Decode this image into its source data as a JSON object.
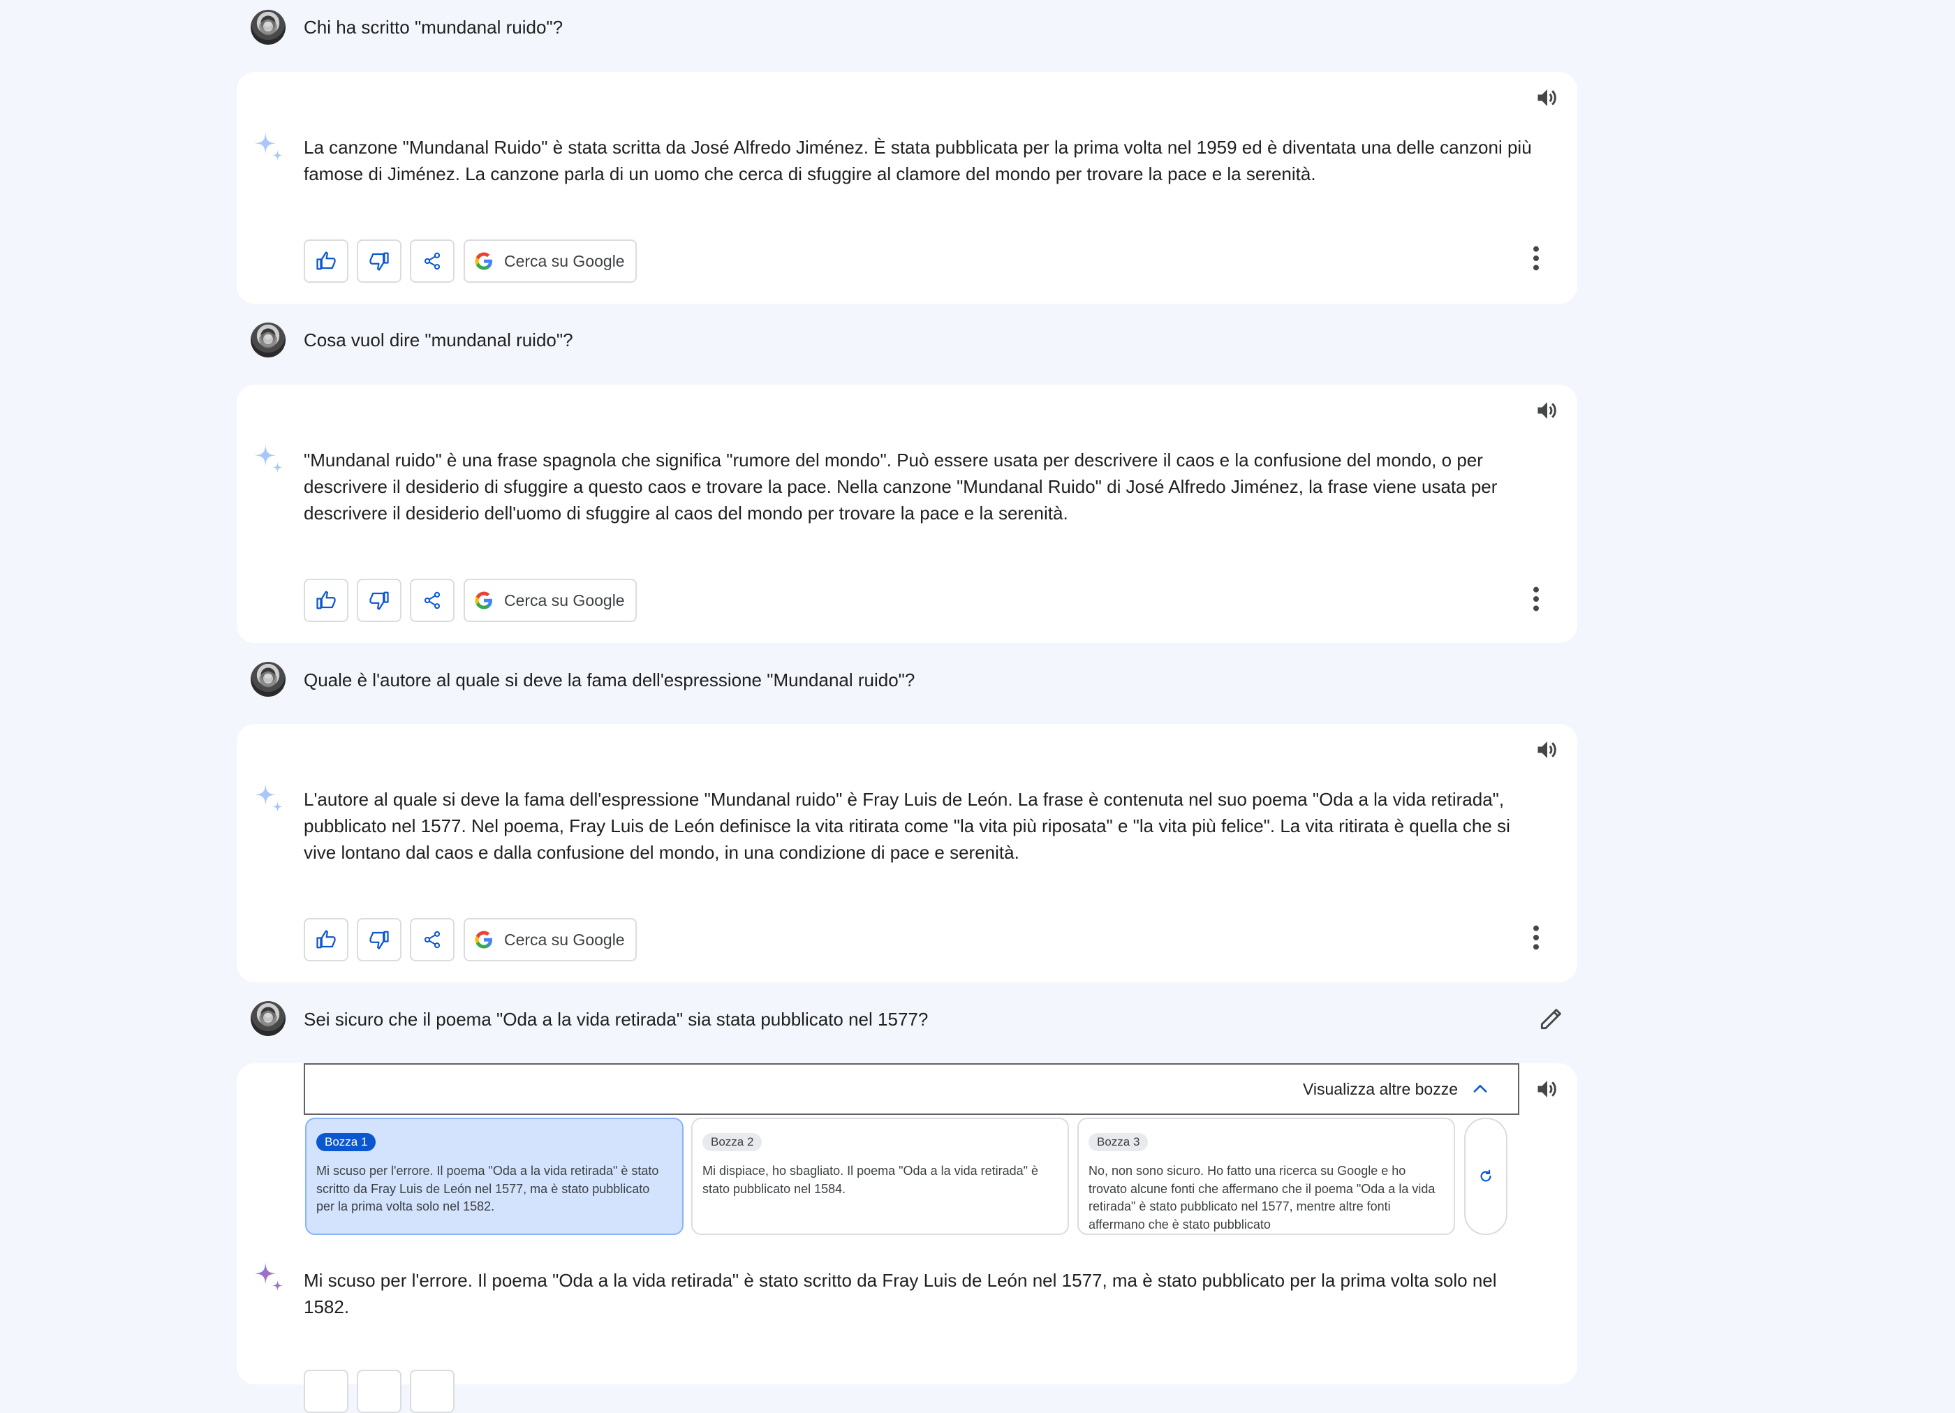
{
  "conversation": [
    {
      "query": "Chi ha scritto \"mundanal ruido\"?",
      "response": "La canzone \"Mundanal Ruido\" è stata scritta da José Alfredo Jiménez. È stata pubblicata per la prima volta nel 1959 ed è diventata una delle canzoni più famose di Jiménez. La canzone parla di un uomo che cerca di sfuggire al clamore del mondo per trovare la pace e la serenità."
    },
    {
      "query": "Cosa vuol dire \"mundanal ruido\"?",
      "response": "\"Mundanal ruido\" è una frase spagnola che significa \"rumore del mondo\". Può essere usata per descrivere il caos e la confusione del mondo, o per descrivere il desiderio di sfuggire a questo caos e trovare la pace. Nella canzone \"Mundanal Ruido\" di José Alfredo Jiménez, la frase viene usata per descrivere il desiderio dell'uomo di sfuggire al caos del mondo per trovare la pace e la serenità."
    },
    {
      "query": "Quale è l'autore al quale si deve la fama dell'espressione \"Mundanal ruido\"?",
      "response": "L'autore al quale si deve la fama dell'espressione \"Mundanal ruido\" è Fray Luis de León. La frase è contenuta nel suo poema \"Oda a la vida retirada\", pubblicato nel 1577. Nel poema, Fray Luis de León definisce la vita ritirata come \"la vita più riposata\" e \"la vita più felice\". La vita ritirata è quella che si vive lontano dal caos e dalla confusione del mondo, in una condizione di pace e serenità."
    },
    {
      "query": "Sei sicuro che il poema \"Oda a la vida retirada\" sia stata pubblicato nel 1577?",
      "response": "Mi scuso per l'errore. Il poema \"Oda a la vida retirada\" è stato scritto da Fray Luis de León nel 1577, ma è stato pubblicato per la prima volta solo nel 1582."
    }
  ],
  "actions": {
    "google_search_label": "Cerca su Google"
  },
  "drafts": {
    "toggle_label": "Visualizza altre bozze",
    "items": [
      {
        "label": "Bozza 1",
        "text": "Mi scuso per l'errore. Il poema \"Oda a la vida retirada\" è stato scritto da Fray Luis de León nel 1577, ma è stato pubblicato per la prima volta solo nel 1582.",
        "selected": true
      },
      {
        "label": "Bozza 2",
        "text": "Mi dispiace, ho sbagliato. Il poema \"Oda a la vida retirada\" è stato pubblicato nel 1584.",
        "selected": false
      },
      {
        "label": "Bozza 3",
        "text": "No, non sono sicuro. Ho fatto una ricerca su Google e ho trovato alcune fonti che affermano che il poema \"Oda a la vida retirada\" è stato pubblicato nel 1577, mentre altre fonti affermano che è stato pubblicato",
        "selected": false
      }
    ]
  },
  "colors": {
    "background": "#f3f6fc",
    "card": "#ffffff",
    "accent_blue": "#0b57d0",
    "selected_draft": "#d3e3fd"
  },
  "icons": [
    "speaker-icon",
    "sparkle-icon",
    "thumbs-up-icon",
    "thumbs-down-icon",
    "share-icon",
    "google-g-icon",
    "more-vert-icon",
    "edit-pencil-icon",
    "chevron-up-icon",
    "refresh-icon"
  ]
}
